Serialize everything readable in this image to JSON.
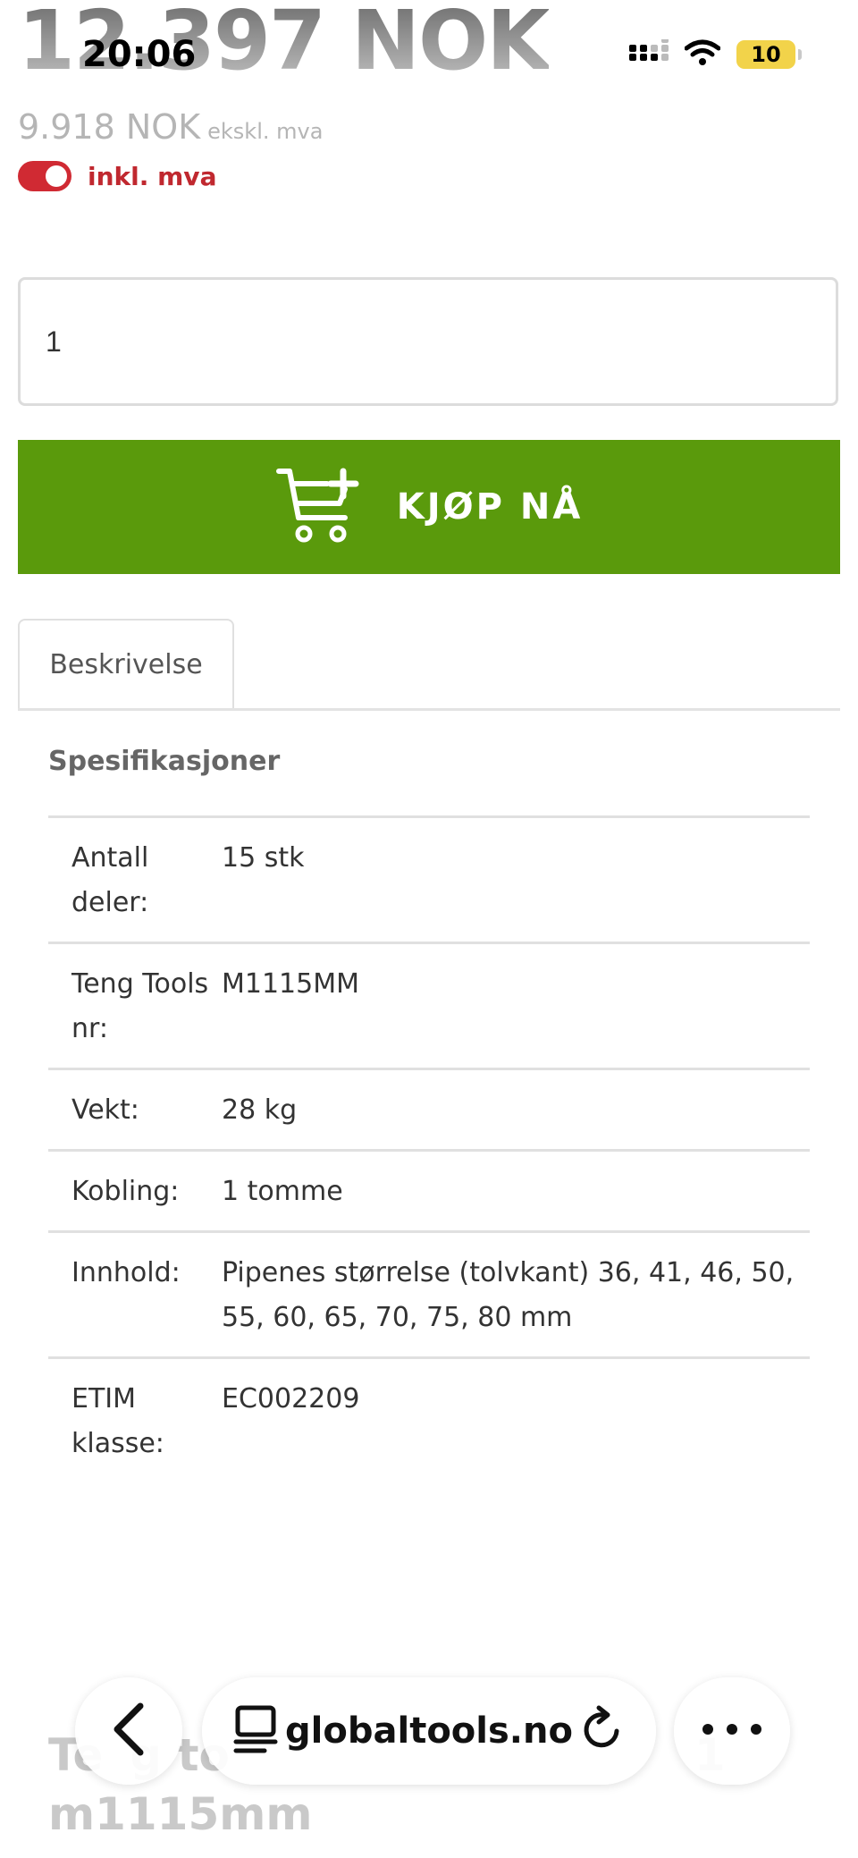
{
  "status": {
    "time": "20:06",
    "battery": "10"
  },
  "price": {
    "incl": "12.397 NOK",
    "excl": "9.918 NOK",
    "excl_suffix": "ekskl. mva",
    "vat_toggle_label": "inkl. mva"
  },
  "quantity": {
    "value": "1"
  },
  "buy_button": {
    "label": "KJØP NÅ",
    "color": "#5a9a0c"
  },
  "tabs": [
    {
      "label": "Beskrivelse"
    }
  ],
  "specs": {
    "title": "Spesifikasjoner",
    "rows": [
      {
        "key": "Antall deler:",
        "value": "15 stk"
      },
      {
        "key": "Teng Tools nr:",
        "value": "M1115MM"
      },
      {
        "key": "Vekt:",
        "value": "28 kg"
      },
      {
        "key": "Kobling:",
        "value": "1 tomme"
      },
      {
        "key": "Innhold:",
        "value": "Pipenes størrelse (tolvkant) 36, 41, 46, 50, 55, 60, 65, 70, 75, 80 mm"
      },
      {
        "key": "ETIM klasse:",
        "value": "EC002209"
      }
    ]
  },
  "bottom_heading": {
    "line1_start": "Te",
    "line1_mid": "g to",
    "line1_end": "1",
    "line2": "m1115mm"
  },
  "browser": {
    "url": "globaltools.no"
  },
  "colors": {
    "accent_red": "#c0282f",
    "buy_green": "#5a9a0c"
  }
}
